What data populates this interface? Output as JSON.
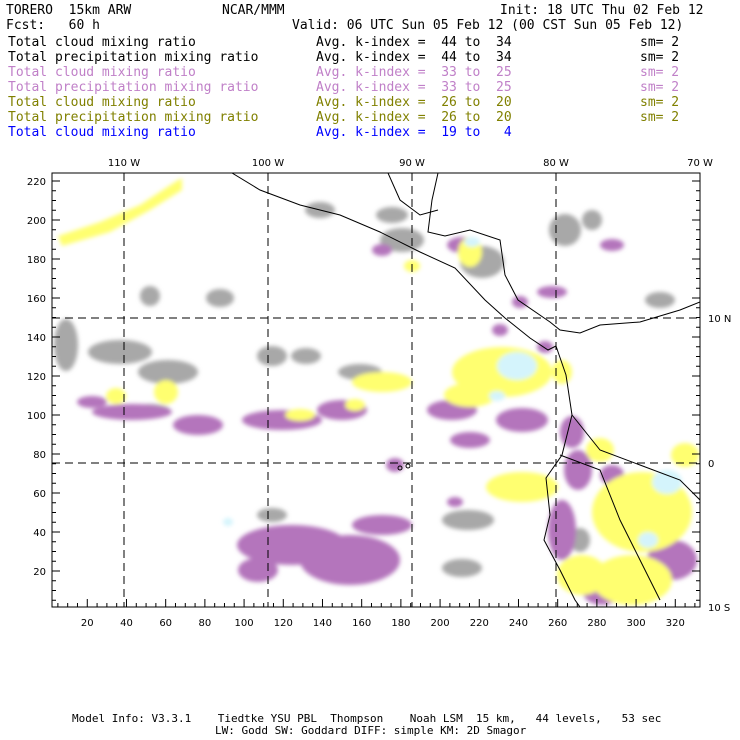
{
  "header": {
    "model": "TORERO  15km ARW",
    "org": "NCAR/MMM",
    "init": "Init: 18 UTC Thu 02 Feb 12",
    "fcst": "Fcst:   60 h",
    "valid": "Valid: 06 UTC Sun 05 Feb 12 (00 CST Sun 05 Feb 12)"
  },
  "legend": [
    {
      "field": "Total cloud mixing ratio",
      "range": "Avg. k-index =  44 to  34",
      "sm": "sm= 2",
      "color": "#000000"
    },
    {
      "field": "Total precipitation mixing ratio",
      "range": "Avg. k-index =  44 to  34",
      "sm": "sm= 2",
      "color": "#000000"
    },
    {
      "field": "Total cloud mixing ratio",
      "range": "Avg. k-index =  33 to  25",
      "sm": "sm= 2",
      "color": "#c080c8"
    },
    {
      "field": "Total precipitation mixing ratio",
      "range": "Avg. k-index =  33 to  25",
      "sm": "sm= 2",
      "color": "#c080c8"
    },
    {
      "field": "Total cloud mixing ratio",
      "range": "Avg. k-index =  26 to  20",
      "sm": "sm= 2",
      "color": "#808000"
    },
    {
      "field": "Total precipitation mixing ratio",
      "range": "Avg. k-index =  26 to  20",
      "sm": "sm= 2",
      "color": "#808000"
    },
    {
      "field": "Total cloud mixing ratio",
      "range": "Avg. k-index =  19 to   4",
      "sm": "",
      "color": "#0000ff"
    }
  ],
  "map": {
    "x_ticks": [
      "20",
      "40",
      "60",
      "80",
      "100",
      "120",
      "140",
      "160",
      "180",
      "200",
      "220",
      "240",
      "260",
      "280",
      "300",
      "320"
    ],
    "y_ticks": [
      "20",
      "40",
      "60",
      "80",
      "100",
      "120",
      "140",
      "160",
      "180",
      "200",
      "220"
    ],
    "lon_labels": [
      "110 W",
      "100 W",
      "90 W",
      "80 W",
      "70 W"
    ],
    "lat_labels": [
      "10 N",
      "0",
      "10 S"
    ],
    "colors": {
      "gray": "#a8a8a8",
      "purple": "#b474bc",
      "yellow": "#ffff70",
      "cyan": "#d4f4fc"
    }
  },
  "footer": {
    "line1": "Model Info: V3.3.1    Tiedtke YSU PBL  Thompson    Noah LSM  15 km,   44 levels,   53 sec",
    "line2": "LW: Godd SW: Goddard DIFF: simple KM: 2D Smagor"
  }
}
